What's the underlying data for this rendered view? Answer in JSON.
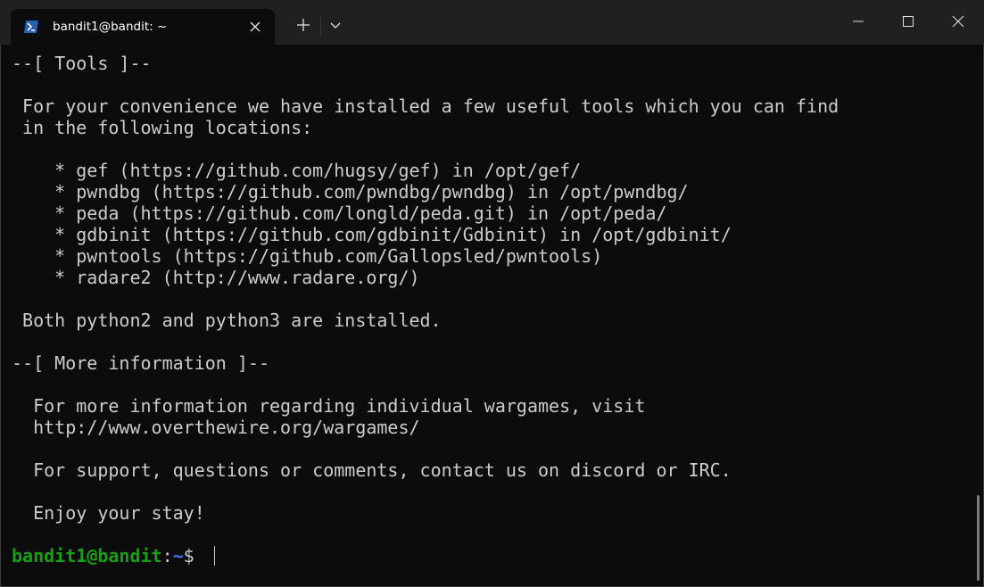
{
  "titlebar": {
    "tab_title": "bandit1@bandit: ~",
    "tab_icon": "powershell-icon",
    "new_tab_icon": "plus-icon",
    "dropdown_icon": "chevron-down-icon",
    "close_tab_icon": "close-icon"
  },
  "terminal": {
    "lines": [
      "--[ Tools ]--",
      "",
      " For your convenience we have installed a few useful tools which you can find",
      " in the following locations:",
      "",
      "    * gef (https://github.com/hugsy/gef) in /opt/gef/",
      "    * pwndbg (https://github.com/pwndbg/pwndbg) in /opt/pwndbg/",
      "    * peda (https://github.com/longld/peda.git) in /opt/peda/",
      "    * gdbinit (https://github.com/gdbinit/Gdbinit) in /opt/gdbinit/",
      "    * pwntools (https://github.com/Gallopsled/pwntools)",
      "    * radare2 (http://www.radare.org/)",
      "",
      " Both python2 and python3 are installed.",
      "",
      "--[ More information ]--",
      "",
      "  For more information regarding individual wargames, visit",
      "  http://www.overthewire.org/wargames/",
      "",
      "  For support, questions or comments, contact us on discord or IRC.",
      "",
      "  Enjoy your stay!"
    ],
    "prompt": {
      "user_host": "bandit1@bandit",
      "colon": ":",
      "path": "~",
      "symbol": "$ "
    }
  },
  "colors": {
    "background": "#0c0c0c",
    "titlebar": "#202020",
    "text": "#cccccc",
    "prompt_user": "#13a10e",
    "prompt_path": "#3b78ff"
  }
}
